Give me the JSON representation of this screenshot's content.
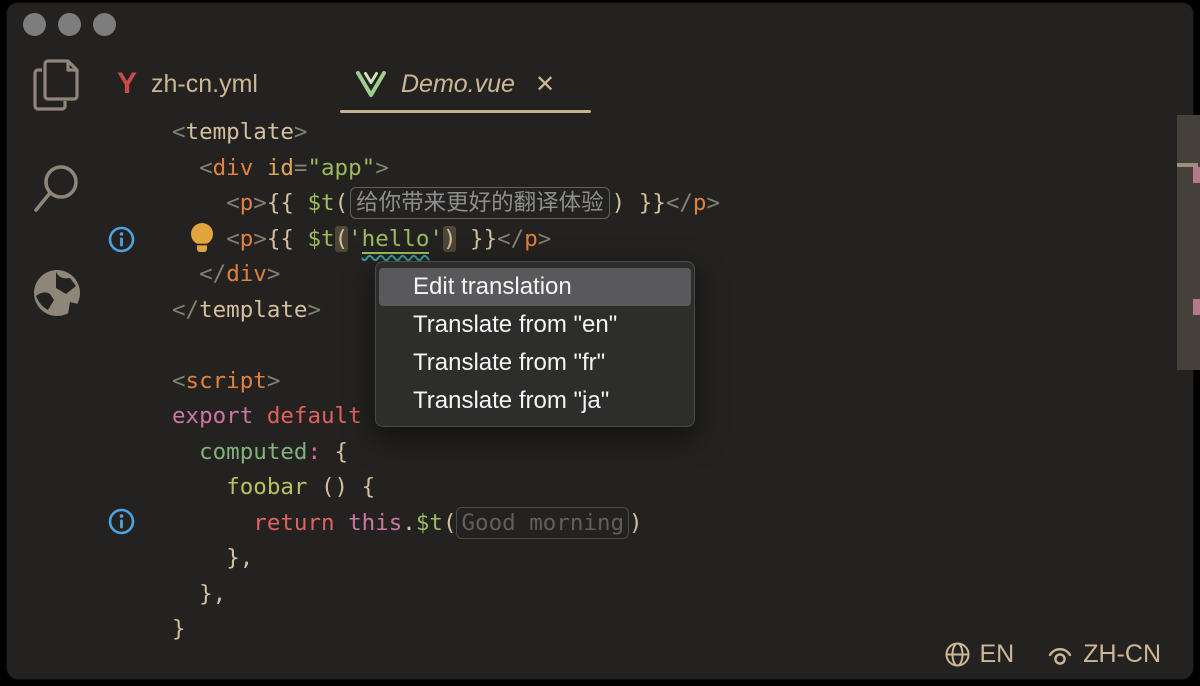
{
  "window": {
    "traffic_lights": [
      "close",
      "minimize",
      "zoom"
    ],
    "accent_colors": {
      "tan": "#d5bf9d",
      "orange": "#e0813e",
      "green": "#9cba5e",
      "pink": "#cb76a3",
      "red": "#e0625f",
      "blue": "#4da3e2",
      "bulb_yellow": "#e2a43d",
      "mark_pink": "#b5798d"
    }
  },
  "activity_bar": {
    "items": [
      {
        "name": "explorer",
        "icon": "files-icon"
      },
      {
        "name": "search",
        "icon": "search-icon"
      },
      {
        "name": "i18n",
        "icon": "globe-icon"
      }
    ]
  },
  "tabs": [
    {
      "label": "zh-cn.yml",
      "icon": "yaml-icon",
      "icon_text": "Y",
      "active": false
    },
    {
      "label": "Demo.vue",
      "icon": "vue-icon",
      "active": true,
      "close_label": "✕"
    }
  ],
  "editor": {
    "lines": [
      [
        [
          "punct",
          "<"
        ],
        [
          "tan",
          "template"
        ],
        [
          "punct",
          ">"
        ]
      ],
      [
        [
          "plain",
          "  "
        ],
        [
          "punct",
          "<"
        ],
        [
          "tag",
          "div"
        ],
        [
          "plain",
          " "
        ],
        [
          "attr",
          "id"
        ],
        [
          "punct",
          "="
        ],
        [
          "str",
          "\"app\""
        ],
        [
          "punct",
          ">"
        ]
      ],
      [
        [
          "plain",
          "    "
        ],
        [
          "punct",
          "<"
        ],
        [
          "tag",
          "p"
        ],
        [
          "punct",
          ">"
        ],
        [
          "tan",
          "{{ "
        ],
        [
          "green",
          "$t"
        ],
        [
          "tan",
          "("
        ],
        [
          "cjk",
          "给你带来更好的翻译体验"
        ],
        [
          "tan",
          ") }}"
        ],
        [
          "punct",
          "</"
        ],
        [
          "tag",
          "p"
        ],
        [
          "punct",
          ">"
        ]
      ],
      [
        [
          "plain",
          "    "
        ],
        [
          "punct",
          "<"
        ],
        [
          "tag",
          "p"
        ],
        [
          "punct",
          ">"
        ],
        [
          "tan",
          "{{ "
        ],
        [
          "green",
          "$t"
        ],
        [
          "bhl",
          "("
        ],
        [
          "str",
          "'"
        ],
        [
          "hello",
          "hello"
        ],
        [
          "str",
          "'"
        ],
        [
          "bhl",
          ")"
        ],
        [
          "tan",
          " }}"
        ],
        [
          "punct",
          "</"
        ],
        [
          "tag",
          "p"
        ],
        [
          "punct",
          ">"
        ]
      ],
      [
        [
          "plain",
          "  "
        ],
        [
          "punct",
          "</"
        ],
        [
          "tag",
          "div"
        ],
        [
          "punct",
          ">"
        ]
      ],
      [
        [
          "punct",
          "</"
        ],
        [
          "tan",
          "template"
        ],
        [
          "punct",
          ">"
        ]
      ],
      [],
      [
        [
          "punct",
          "<"
        ],
        [
          "tag",
          "script"
        ],
        [
          "punct",
          ">"
        ]
      ],
      [
        [
          "kw1",
          "export"
        ],
        [
          "plain",
          " "
        ],
        [
          "kw2",
          "default"
        ]
      ],
      [
        [
          "plain",
          "  "
        ],
        [
          "prop",
          "computed"
        ],
        [
          "colon",
          ":"
        ],
        [
          "tan",
          " {"
        ]
      ],
      [
        [
          "plain",
          "    "
        ],
        [
          "func",
          "foobar"
        ],
        [
          "tan",
          " () {"
        ]
      ],
      [
        [
          "plain",
          "      "
        ],
        [
          "kw2",
          "return"
        ],
        [
          "plain",
          " "
        ],
        [
          "kw1",
          "this"
        ],
        [
          "tan",
          "."
        ],
        [
          "green",
          "$t"
        ],
        [
          "tan",
          "("
        ],
        [
          "ph",
          "Good morning"
        ],
        [
          "tan",
          ")"
        ]
      ],
      [
        [
          "plain",
          "    "
        ],
        [
          "tan",
          "},"
        ]
      ],
      [
        [
          "plain",
          "  "
        ],
        [
          "tan",
          "},"
        ]
      ],
      [
        [
          "tan",
          "}"
        ]
      ]
    ],
    "gutter": [
      {
        "line": 4,
        "icons": [
          "info-icon",
          "lightbulb-icon"
        ]
      },
      {
        "line": 12,
        "icons": [
          "info-icon"
        ]
      }
    ]
  },
  "context_menu": {
    "items": [
      {
        "label": "Edit translation",
        "highlighted": true
      },
      {
        "label": "Translate from \"en\"",
        "highlighted": false
      },
      {
        "label": "Translate from \"fr\"",
        "highlighted": false
      },
      {
        "label": "Translate from \"ja\"",
        "highlighted": false
      }
    ]
  },
  "status_bar": {
    "source_locale": "EN",
    "display_locale": "ZH-CN"
  }
}
